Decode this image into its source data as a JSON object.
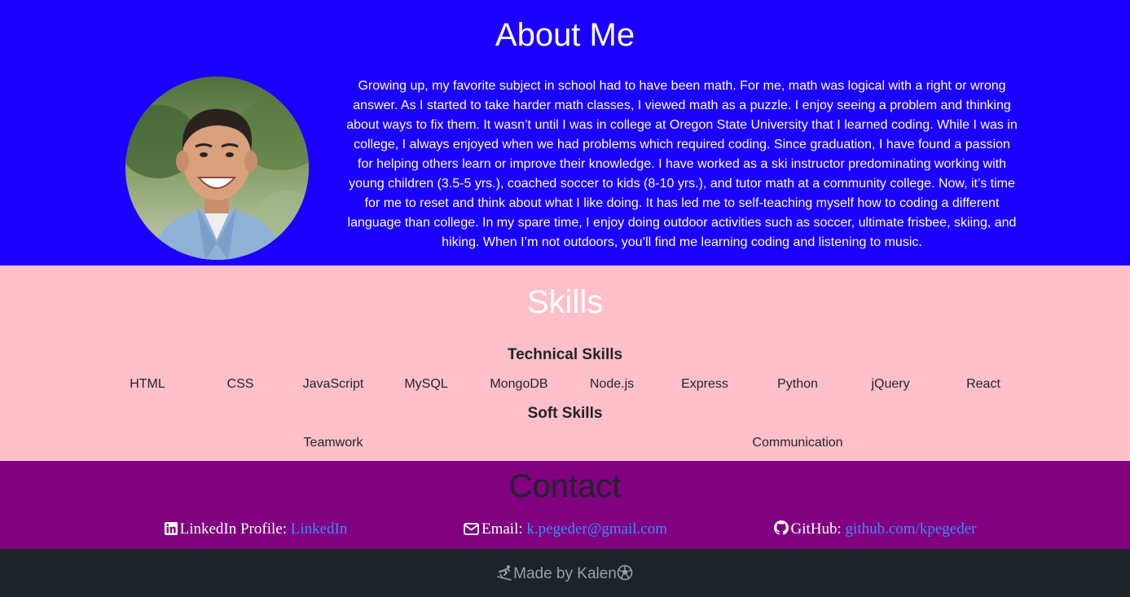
{
  "about": {
    "title": "About Me",
    "text": "Growing up, my favorite subject in school had to have been math. For me, math was logical with a right or wrong answer. As I started to take harder math classes, I viewed math as a puzzle. I enjoy seeing a problem and thinking about ways to fix them. It wasn’t until I was in college at Oregon State University that I learned coding. While I was in college, I always enjoyed when we had problems which required coding. Since graduation, I have found a passion for helping others learn or improve their knowledge. I have worked as a ski instructor predominating working with young children (3.5-5 yrs.), coached soccer to kids (8-10 yrs.), and tutor math at a community college. Now, it’s time for me to reset and think about what I like doing. It has led me to self-teaching myself how to coding a different language than college. In my spare time, I enjoy doing outdoor activities such as soccer, ultimate frisbee, skiing, and hiking. When I’m not outdoors, you’ll find me learning coding and listening to music."
  },
  "skills": {
    "title": "Skills",
    "technical_title": "Technical Skills",
    "technical": [
      "HTML",
      "CSS",
      "JavaScript",
      "MySQL",
      "MongoDB",
      "Node.js",
      "Express",
      "Python",
      "jQuery",
      "React"
    ],
    "soft_title": "Soft Skills",
    "soft": [
      "Teamwork",
      "Communication"
    ]
  },
  "contact": {
    "title": "Contact",
    "linkedin": {
      "icon": "linkedin-icon",
      "label": "LinkedIn Profile: ",
      "link": "LinkedIn"
    },
    "email": {
      "icon": "envelope-icon",
      "label": "Email: ",
      "link": "k.pegeder@gmail.com"
    },
    "github": {
      "icon": "github-icon",
      "label": "GitHub: ",
      "link": "github.com/kpegeder"
    }
  },
  "footer": {
    "text": "Made by Kalen",
    "left_icon": "skiing-icon",
    "right_icon": "soccer-ball-icon"
  },
  "colors": {
    "about_bg": "#1b00ff",
    "skills_bg": "#ffc0cb",
    "contact_bg": "#800080",
    "footer_bg": "#1c2329",
    "link": "#3d8bfd"
  }
}
